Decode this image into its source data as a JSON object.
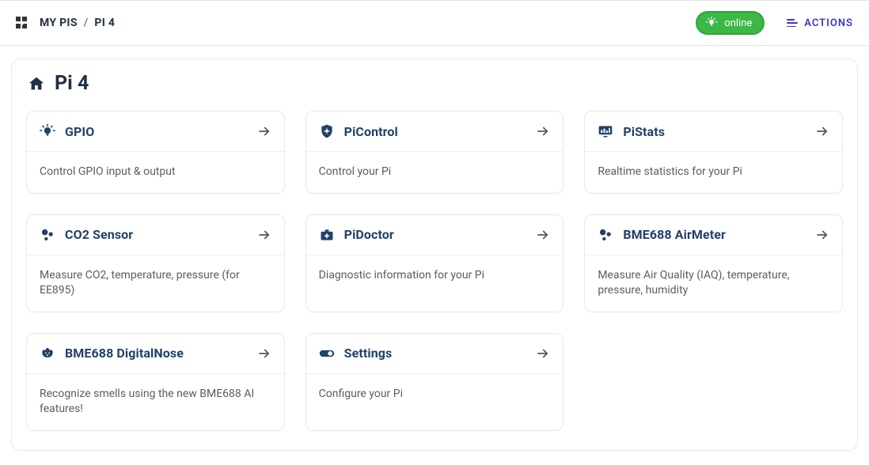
{
  "breadcrumb": {
    "root": "MY PIS",
    "current": "PI 4"
  },
  "status": {
    "label": "online"
  },
  "actions": {
    "label": "ACTIONS"
  },
  "page": {
    "title": "Pi 4"
  },
  "cards": [
    {
      "id": "gpio",
      "title": "GPIO",
      "desc": "Control GPIO input & output",
      "icon": "bulb"
    },
    {
      "id": "picontrol",
      "title": "PiControl",
      "desc": "Control your Pi",
      "icon": "shield"
    },
    {
      "id": "pistats",
      "title": "PiStats",
      "desc": "Realtime statistics for your Pi",
      "icon": "monitor"
    },
    {
      "id": "co2",
      "title": "CO2 Sensor",
      "desc": "Measure CO2, temperature, pressure (for EE895)",
      "icon": "bubbles"
    },
    {
      "id": "pidoctor",
      "title": "PiDoctor",
      "desc": "Diagnostic information for your Pi",
      "icon": "medkit"
    },
    {
      "id": "bme688air",
      "title": "BME688 AirMeter",
      "desc": "Measure Air Quality (IAQ), temperature, pressure, humidity",
      "icon": "bubbles"
    },
    {
      "id": "bme688nose",
      "title": "BME688 DigitalNose",
      "desc": "Recognize smells using the new BME688 AI features!",
      "icon": "dog"
    },
    {
      "id": "settings",
      "title": "Settings",
      "desc": "Configure your Pi",
      "icon": "toggle"
    }
  ]
}
